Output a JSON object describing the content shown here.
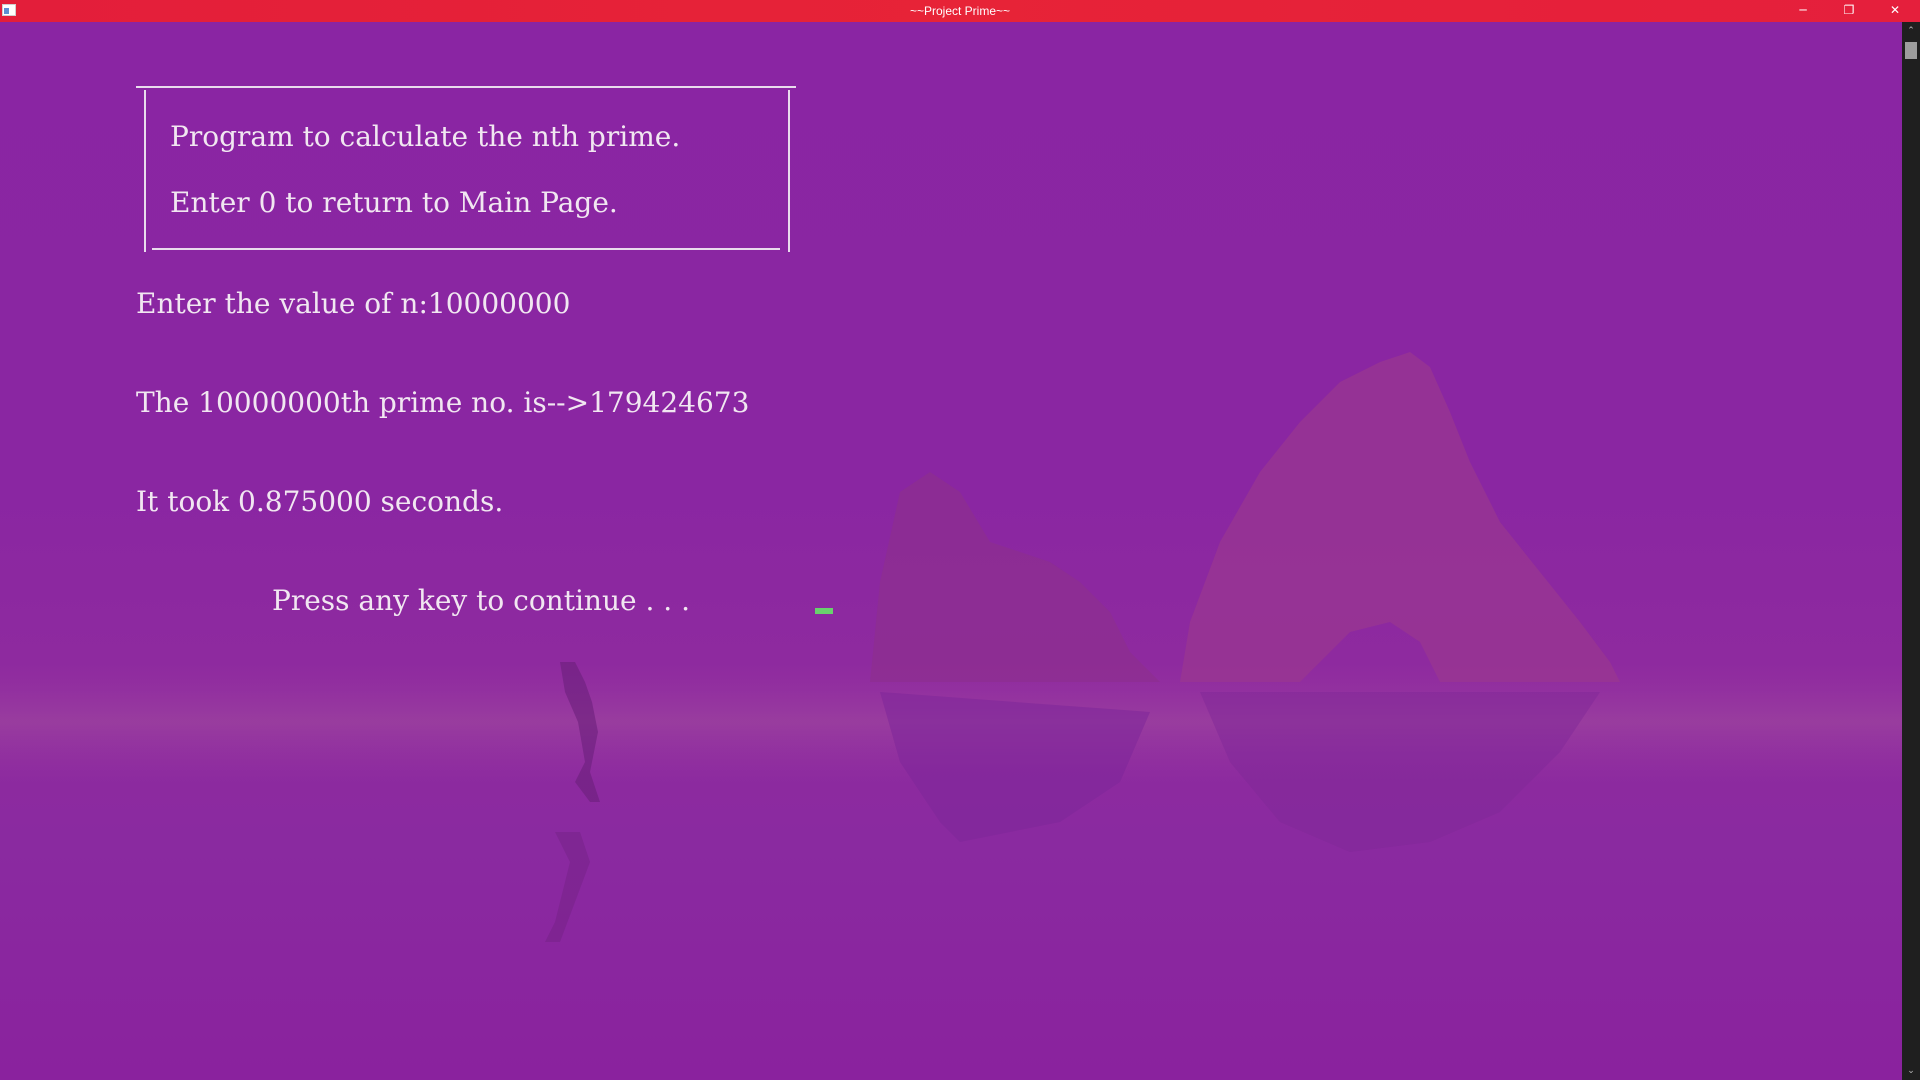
{
  "window": {
    "title": "~~Project Prime~~",
    "controls": {
      "minimize": "─",
      "maximize": "❐",
      "close": "✕"
    },
    "accent_color": "#e41f3b",
    "background_color": "#8b23a2"
  },
  "console": {
    "box_lines": [
      "Program to calculate the nth prime.",
      "Enter 0 to return to Main Page."
    ],
    "prompt_line": "Enter the value of n:10000000",
    "result_line": "The 10000000th prime no. is-->179424673",
    "time_line": "It took 0.875000 seconds.",
    "continue_line": "Press any key to continue . . .",
    "cursor_color": "#69d16d"
  },
  "scrollbar": {
    "up_arrow": "⌃",
    "down_arrow": "⌄"
  }
}
